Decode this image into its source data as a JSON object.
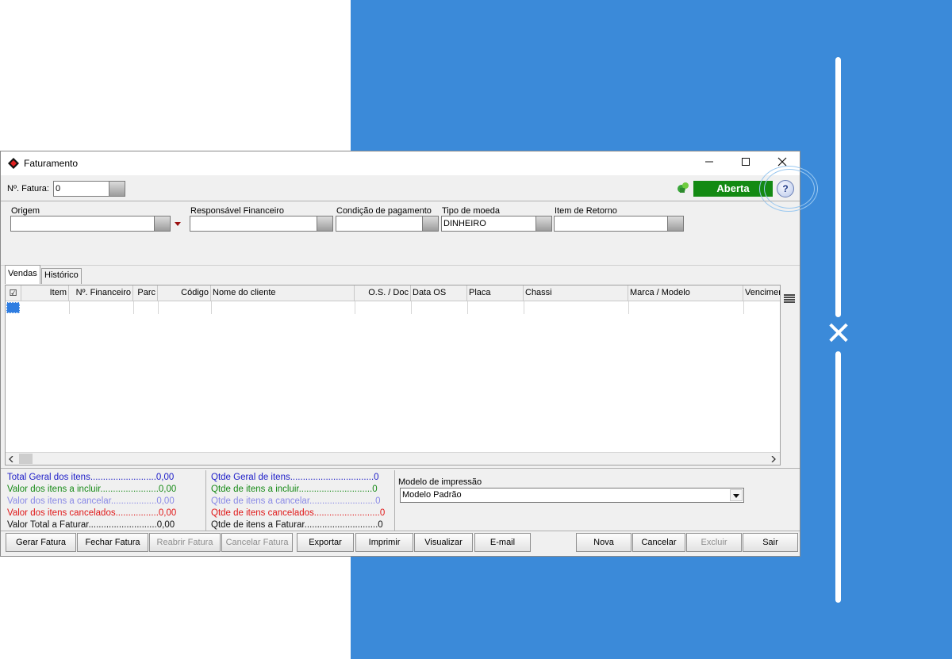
{
  "window": {
    "title": "Faturamento"
  },
  "header": {
    "fatura_label": "Nº. Fatura:",
    "fatura_value": "0",
    "status": "Aberta",
    "status_color": "#138a13"
  },
  "filters": {
    "origem_label": "Origem",
    "origem_value": "",
    "responsavel_label": "Responsável Financeiro",
    "responsavel_value": "",
    "condicao_label": "Condição de pagamento",
    "condicao_value": "",
    "moeda_label": "Tipo de moeda",
    "moeda_value": "DINHEIRO",
    "retorno_label": "Item de Retorno",
    "retorno_value": ""
  },
  "tabs": [
    {
      "label": "Vendas",
      "active": true
    },
    {
      "label": "Histórico",
      "active": false
    }
  ],
  "grid": {
    "columns": [
      "☑",
      "Item",
      "Nº. Financeiro",
      "Parc",
      "Código",
      "Nome do cliente",
      "O.S. / Doc",
      "Data OS",
      "Placa",
      "Chassi",
      "Marca / Modelo",
      "Vencimen"
    ],
    "rows": []
  },
  "totals_left": [
    {
      "label": "Total Geral dos itens..........................0,00",
      "color": "#1c1cc8"
    },
    {
      "label": "Valor dos itens a incluir.......................0,00",
      "color": "#178a17"
    },
    {
      "label": "Valor dos itens a cancelar..................0,00",
      "color": "#8a8ae6"
    },
    {
      "label": "Valor dos itens cancelados.................0,00",
      "color": "#e01818"
    },
    {
      "label": "Valor Total a Faturar...........................0,00",
      "color": "#111111"
    }
  ],
  "totals_right": [
    {
      "label": "Qtde Geral de itens.................................0",
      "color": "#1c1cc8"
    },
    {
      "label": "Qtde de itens a incluir.............................0",
      "color": "#178a17"
    },
    {
      "label": "Qtde de itens a cancelar..........................0",
      "color": "#8a8ae6"
    },
    {
      "label": "Qtde de itens cancelados..........................0",
      "color": "#e01818"
    },
    {
      "label": "Qtde de itens a Faturar.............................0",
      "color": "#111111"
    }
  ],
  "print_model": {
    "label": "Modelo de impressão",
    "value": "Modelo Padrão"
  },
  "buttons": {
    "gerar": "Gerar Fatura",
    "fechar": "Fechar Fatura",
    "reabrir": "Reabrir Fatura",
    "cancelar_fatura": "Cancelar Fatura",
    "exportar": "Exportar",
    "imprimir": "Imprimir",
    "visualizar": "Visualizar",
    "email": "E-mail",
    "nova": "Nova",
    "cancelar": "Cancelar",
    "excluir": "Excluir",
    "sair": "Sair"
  },
  "colors": {
    "background_accent": "#3b8ad9"
  }
}
